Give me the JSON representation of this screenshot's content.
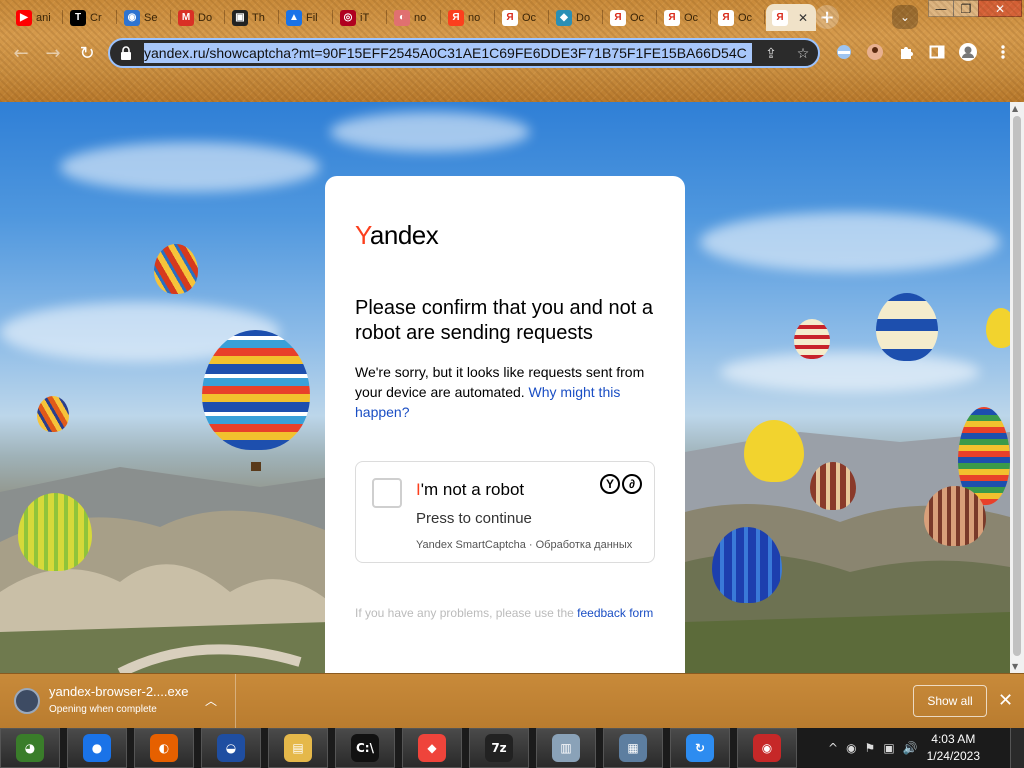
{
  "browser": {
    "tabs": [
      {
        "label": "ani",
        "fav": "youtube-icon",
        "color": "#ff0000",
        "glyph": "▶"
      },
      {
        "label": "Cr",
        "fav": "t-icon",
        "color": "#000000",
        "glyph": "T"
      },
      {
        "label": "Se",
        "fav": "circle-icon",
        "color": "#2f74d0",
        "glyph": "◉"
      },
      {
        "label": "Do",
        "fav": "gmail-icon",
        "color": "#d93025",
        "glyph": "M"
      },
      {
        "label": "Th",
        "fav": "monitor-icon",
        "color": "#222222",
        "glyph": "▣"
      },
      {
        "label": "Fil",
        "fav": "drive-icon",
        "color": "#1a73e8",
        "glyph": "▲"
      },
      {
        "label": "iT",
        "fav": "record-icon",
        "color": "#b00020",
        "glyph": "◎"
      },
      {
        "label": "no",
        "fav": "eye-icon",
        "color": "#e07070",
        "glyph": "◐"
      },
      {
        "label": "no",
        "fav": "yandex-icon",
        "color": "#fc3f1d",
        "glyph": "Я"
      },
      {
        "label": "Oc",
        "fav": "yandex-icon",
        "color": "#ffffff",
        "glyph": "Я"
      },
      {
        "label": "Do",
        "fav": "diamond-icon",
        "color": "#2a8fb5",
        "glyph": "◆"
      },
      {
        "label": "Oc",
        "fav": "yandex-icon",
        "color": "#ffffff",
        "glyph": "Я"
      },
      {
        "label": "Oc",
        "fav": "yandex-icon",
        "color": "#ffffff",
        "glyph": "Я"
      },
      {
        "label": "Oc",
        "fav": "yandex-icon",
        "color": "#ffffff",
        "glyph": "Я"
      }
    ],
    "active_tab": {
      "fav": "yandex-icon",
      "glyph": "Я",
      "close": "✕"
    },
    "new_tab": "+",
    "tab_search": "⌄",
    "window_buttons": {
      "minimize": "—",
      "maximize": "❐",
      "close": "✕"
    },
    "nav": {
      "back": "←",
      "forward": "→",
      "reload": "↻"
    },
    "url": "yandex.ru/showcaptcha?mt=90F15EFF2545A0C31AE1C69FE6DDE3F71B75F1FE15BA66D54C",
    "omnibox_icons": {
      "lock": "🔒",
      "share": "⇪",
      "bookmark": "☆"
    },
    "extensions": [
      "toggle-icon",
      "avatar-icon",
      "puzzle-icon",
      "sidepanel-icon",
      "profile-icon",
      "menu-icon"
    ]
  },
  "page": {
    "logo": {
      "y": "Y",
      "rest": "andex"
    },
    "heading": "Please confirm that you and not a robot are sending requests",
    "description": "We're sorry, but it looks like requests sent from your device are automated.",
    "why_link": "Why might this happen?",
    "captcha": {
      "title_i": "I",
      "title_rest": "'m not a robot",
      "press": "Press to continue",
      "footer": "Yandex SmartCaptcha · Обработка данных",
      "logo_letters": [
        "Y",
        "∂"
      ]
    },
    "problems_text": "If you have any problems, please use the",
    "feedback_link": "feedback form"
  },
  "downloads": {
    "file_name": "yandex-browser-2....exe",
    "status": "Opening when complete",
    "show_all": "Show all",
    "close": "✕"
  },
  "taskbar": {
    "apps": [
      {
        "name": "chrome-alt-icon",
        "color": "#3a7d2a",
        "glyph": "◕"
      },
      {
        "name": "chrome-icon",
        "color": "#1a73e8",
        "glyph": "●"
      },
      {
        "name": "firefox-icon",
        "color": "#e66000",
        "glyph": "◐"
      },
      {
        "name": "obama-icon",
        "color": "#1f4ea1",
        "glyph": "◒"
      },
      {
        "name": "folder-icon",
        "color": "#e5b84a",
        "glyph": "▤"
      },
      {
        "name": "cmd-icon",
        "color": "#111111",
        "glyph": "C:\\"
      },
      {
        "name": "anydesk-icon",
        "color": "#ef443b",
        "glyph": "◆"
      },
      {
        "name": "7zip-icon",
        "color": "#222222",
        "glyph": "7z"
      },
      {
        "name": "monitor-icon",
        "color": "#8aa2b8",
        "glyph": "▥"
      },
      {
        "name": "network-icon",
        "color": "#5d7ea0",
        "glyph": "▦"
      },
      {
        "name": "sync-icon",
        "color": "#2d8cf0",
        "glyph": "↻"
      },
      {
        "name": "recorder-icon",
        "color": "#c62828",
        "glyph": "◉"
      }
    ],
    "tray_icons": [
      "^",
      "◉",
      "⚑",
      "▣",
      "🔊"
    ],
    "time": "4:03 AM",
    "date": "1/24/2023"
  }
}
